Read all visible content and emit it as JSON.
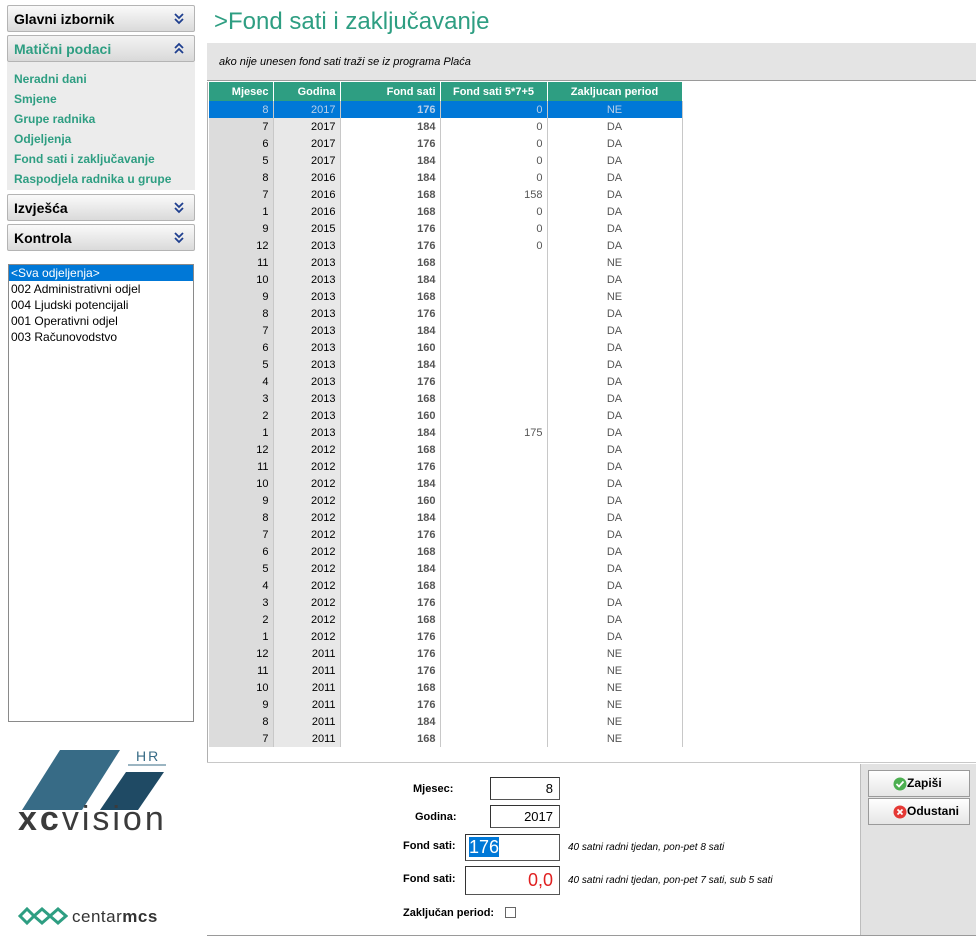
{
  "sidebar": {
    "sections": [
      {
        "label": "Glavni izbornik",
        "open": false
      },
      {
        "label": "Matični podaci",
        "open": true
      },
      {
        "label": "Izvješća",
        "open": false
      },
      {
        "label": "Kontrola",
        "open": false
      }
    ],
    "menu_items": [
      {
        "label": "Neradni dani"
      },
      {
        "label": "Smjene"
      },
      {
        "label": "Grupe radnika"
      },
      {
        "label": "Odjeljenja"
      },
      {
        "label": "Fond sati i zaključavanje"
      },
      {
        "label": "Raspodjela radnika u grupe"
      }
    ],
    "departments": [
      {
        "label": "<Sva odjeljenja>",
        "selected": true
      },
      {
        "label": "002 Administrativni odjel",
        "selected": false
      },
      {
        "label": "004 Ljudski potencijali",
        "selected": false
      },
      {
        "label": "001 Operativni odjel",
        "selected": false
      },
      {
        "label": "003 Računovodstvo",
        "selected": false
      }
    ]
  },
  "branding": {
    "logo_hr": "HR",
    "logo_xc": "xc",
    "logo_vision": "vision",
    "cmcs_centar": "centar",
    "cmcs_mcs": "mcs",
    "accent": "#2e9e82",
    "logo_blue": "#376b86"
  },
  "page": {
    "title": ">Fond sati i zaključavanje",
    "info": "ako nije unesen fond sati traži se iz programa Plaća"
  },
  "table": {
    "headers": [
      "Mjesec",
      "Godina",
      "Fond sati",
      "Fond sati 5*7+5",
      "Zakljucan period"
    ],
    "rows": [
      [
        "8",
        "2017",
        "176",
        "0",
        "NE"
      ],
      [
        "7",
        "2017",
        "184",
        "0",
        "DA"
      ],
      [
        "6",
        "2017",
        "176",
        "0",
        "DA"
      ],
      [
        "5",
        "2017",
        "184",
        "0",
        "DA"
      ],
      [
        "8",
        "2016",
        "184",
        "0",
        "DA"
      ],
      [
        "7",
        "2016",
        "168",
        "158",
        "DA"
      ],
      [
        "1",
        "2016",
        "168",
        "0",
        "DA"
      ],
      [
        "9",
        "2015",
        "176",
        "0",
        "DA"
      ],
      [
        "12",
        "2013",
        "176",
        "0",
        "DA"
      ],
      [
        "11",
        "2013",
        "168",
        "",
        "NE"
      ],
      [
        "10",
        "2013",
        "184",
        "",
        "DA"
      ],
      [
        "9",
        "2013",
        "168",
        "",
        "NE"
      ],
      [
        "8",
        "2013",
        "176",
        "",
        "DA"
      ],
      [
        "7",
        "2013",
        "184",
        "",
        "DA"
      ],
      [
        "6",
        "2013",
        "160",
        "",
        "DA"
      ],
      [
        "5",
        "2013",
        "184",
        "",
        "DA"
      ],
      [
        "4",
        "2013",
        "176",
        "",
        "DA"
      ],
      [
        "3",
        "2013",
        "168",
        "",
        "DA"
      ],
      [
        "2",
        "2013",
        "160",
        "",
        "DA"
      ],
      [
        "1",
        "2013",
        "184",
        "175",
        "DA"
      ],
      [
        "12",
        "2012",
        "168",
        "",
        "DA"
      ],
      [
        "11",
        "2012",
        "176",
        "",
        "DA"
      ],
      [
        "10",
        "2012",
        "184",
        "",
        "DA"
      ],
      [
        "9",
        "2012",
        "160",
        "",
        "DA"
      ],
      [
        "8",
        "2012",
        "184",
        "",
        "DA"
      ],
      [
        "7",
        "2012",
        "176",
        "",
        "DA"
      ],
      [
        "6",
        "2012",
        "168",
        "",
        "DA"
      ],
      [
        "5",
        "2012",
        "184",
        "",
        "DA"
      ],
      [
        "4",
        "2012",
        "168",
        "",
        "DA"
      ],
      [
        "3",
        "2012",
        "176",
        "",
        "DA"
      ],
      [
        "2",
        "2012",
        "168",
        "",
        "DA"
      ],
      [
        "1",
        "2012",
        "176",
        "",
        "DA"
      ],
      [
        "12",
        "2011",
        "176",
        "",
        "NE"
      ],
      [
        "11",
        "2011",
        "176",
        "",
        "NE"
      ],
      [
        "10",
        "2011",
        "168",
        "",
        "NE"
      ],
      [
        "9",
        "2011",
        "176",
        "",
        "NE"
      ],
      [
        "8",
        "2011",
        "184",
        "",
        "NE"
      ],
      [
        "7",
        "2011",
        "168",
        "",
        "NE"
      ]
    ],
    "selected_row": 0
  },
  "form": {
    "mjesec_label": "Mjesec:",
    "mjesec_value": "8",
    "godina_label": "Godina:",
    "godina_value": "2017",
    "fond1_label": "Fond sati:",
    "fond1_value": "176",
    "fond1_hint": "40 satni radni tjedan, pon-pet 8 sati",
    "fond2_label": "Fond sati:",
    "fond2_value": "0,0",
    "fond2_hint": "40 satni radni tjedan, pon-pet 7 sati, sub 5 sati",
    "zakljucan_label": "Zaključan period:",
    "zakljucan_checked": false
  },
  "buttons": {
    "save_label": "Zapiši",
    "cancel_label": "Odustani"
  }
}
